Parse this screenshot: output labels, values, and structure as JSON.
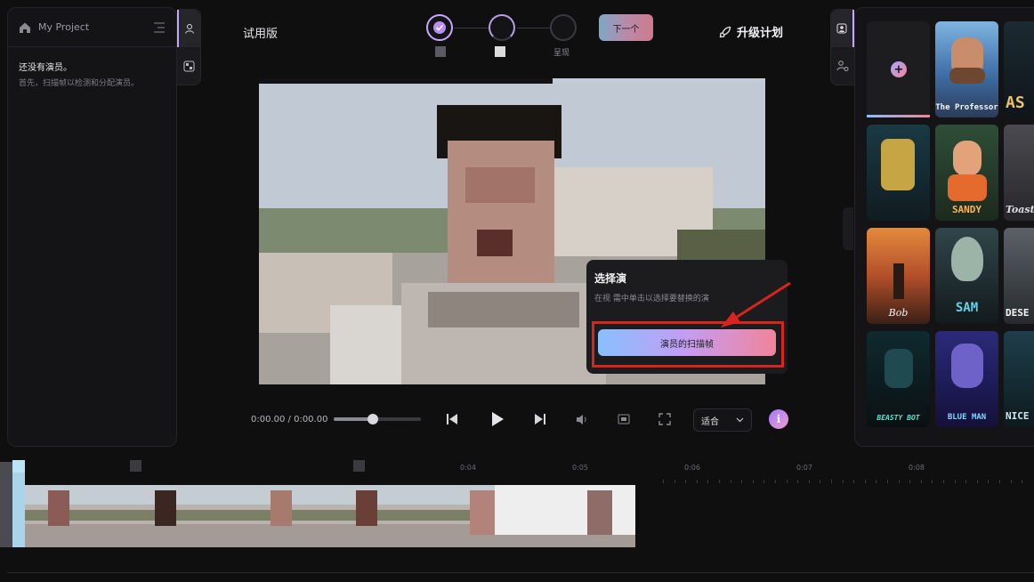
{
  "header": {
    "project_name": "My Project",
    "trial_label": "试用版",
    "next_label": "下一个",
    "upgrade_label": "升级计划",
    "steps": [
      {
        "label": ""
      },
      {
        "label": ""
      },
      {
        "label": "呈现"
      }
    ]
  },
  "left_panel": {
    "empty_title": "还没有演员。",
    "empty_sub": "首先，扫描帧以检测和分配演员。"
  },
  "popup": {
    "title": "选择演",
    "desc": "在视          需中单击以选择要替换的演",
    "button_label": "演员的扫描帧"
  },
  "controls": {
    "time": "0:00.00 / 0:00.00",
    "volume_fraction": 0.45,
    "fit_label": "适合",
    "info_glyph": "i"
  },
  "actors": [
    {
      "label": ""
    },
    {
      "label": "The Professor"
    },
    {
      "label": "AS"
    },
    {
      "label": ""
    },
    {
      "label": "SANDY"
    },
    {
      "label": "Toast"
    },
    {
      "label": "Bob"
    },
    {
      "label": "SAM"
    },
    {
      "label": "DESE"
    },
    {
      "label": "BEASTY BOT"
    },
    {
      "label": "BLUE MAN"
    },
    {
      "label": "NICE"
    }
  ],
  "timeline": {
    "ticks": [
      "0:04",
      "0:05",
      "0:06",
      "0:07",
      "0:08"
    ]
  },
  "colors": {
    "accent_gradient_start": "#88c0ff",
    "accent_gradient_end": "#f1849a",
    "highlight_red": "#d6251f",
    "panel_bg": "#141416"
  }
}
